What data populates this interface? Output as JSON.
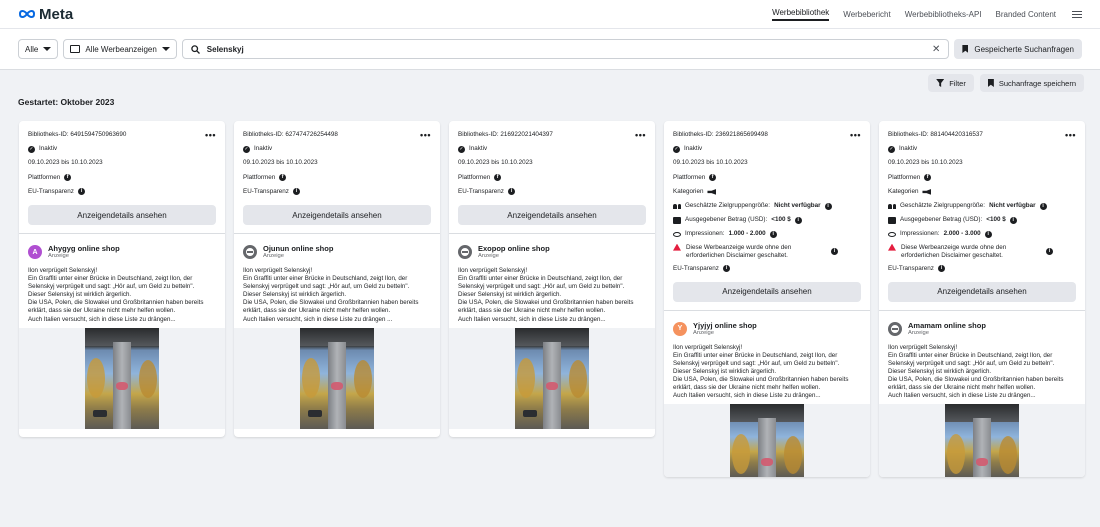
{
  "header": {
    "logo_text": "Meta",
    "nav": [
      {
        "label": "Werbebibliothek",
        "active": true
      },
      {
        "label": "Werbebericht",
        "active": false
      },
      {
        "label": "Werbebibliotheks-API",
        "active": false
      },
      {
        "label": "Branded Content",
        "active": false
      }
    ]
  },
  "search": {
    "country": "Alle",
    "ad_category": "Alle Werbeanzeigen",
    "query": "Selenskyj",
    "saved_searches_label": "Gespeicherte Suchanfragen"
  },
  "toolbar": {
    "filter_label": "Filter",
    "save_search_label": "Suchanfrage speichern"
  },
  "section_title": "Gestartet: Oktober 2023",
  "colors": {
    "accent": "#1c1e21",
    "warning": "#e41e3f",
    "avatar_purple": "#b04fd1",
    "avatar_orange": "#f5925e"
  },
  "cards": [
    {
      "library_id": "Bibliotheks-ID: 649159475096369​0",
      "status": "Inaktiv",
      "dates": "09.10.2023 bis 10.10.2023",
      "platforms_label": "Plattformen",
      "eu_label": "EU-Transparenz",
      "details_button": "Anzeigendetails ansehen",
      "advertiser": "Ahygyg online shop",
      "advertiser_initial": "A",
      "sponsored": "Anzeige",
      "ad_text": [
        "Ilon verprügelt Selenskyj!",
        "Ein Graffiti unter einer Brücke in Deutschland, zeigt Ilon, der Selenskyj verprügelt und sagt: „Hör auf, um Geld zu betteln\".",
        "Dieser Selenskyj ist wirklich ärgerlich.",
        "Die USA, Polen, die Slowakei und Großbritannien haben bereits erklärt, dass sie der Ukraine nicht mehr helfen wollen.",
        "Auch Italien versucht, sich in diese Liste zu drängen..."
      ]
    },
    {
      "library_id": "Bibliotheks-ID: 627474726254498",
      "status": "Inaktiv",
      "dates": "09.10.2023 bis 10.10.2023",
      "platforms_label": "Plattformen",
      "eu_label": "EU-Transparenz",
      "details_button": "Anzeigendetails ansehen",
      "advertiser": "Ojunun online shop",
      "sponsored": "Anzeige",
      "ad_text": [
        "Ilon verprügelt Selenskyj!",
        "Ein Graffiti unter einer Brücke in Deutschland, zeigt Ilon, der Selenskyj verprügelt und sagt: „Hör auf, um Geld zu betteln\".",
        "Dieser Selenskyj ist wirklich ärgerlich.",
        "Die USA, Polen, die Slowakei und Großbritannien haben bereits erklärt, dass sie der Ukraine nicht mehr helfen wollen.",
        "Auch Italien versucht, sich in diese Liste zu drängen ..."
      ]
    },
    {
      "library_id": "Bibliotheks-ID: 216922021404397",
      "status": "Inaktiv",
      "dates": "09.10.2023 bis 10.10.2023",
      "platforms_label": "Plattformen",
      "eu_label": "EU-Transparenz",
      "details_button": "Anzeigendetails ansehen",
      "advertiser": "Exopop online shop",
      "sponsored": "Anzeige",
      "ad_text": [
        "Ilon verprügelt Selenskyj!",
        "Ein Graffiti unter einer Brücke in Deutschland, zeigt Ilon, der Selenskyj verprügelt und sagt: „Hör auf, um Geld zu betteln\".",
        "Dieser Selenskyj ist wirklich ärgerlich.",
        "Die USA, Polen, die Slowakei und Großbritannien haben bereits erklärt, dass sie der Ukraine nicht mehr helfen wollen.",
        "Auch Italien versucht, sich in diese Liste zu drängen..."
      ]
    },
    {
      "library_id": "Bibliotheks-ID: 236921865699498",
      "status": "Inaktiv",
      "dates": "09.10.2023 bis 10.10.2023",
      "platforms_label": "Plattformen",
      "categories_label": "Kategorien",
      "audience_label": "Geschätzte Zielgruppengröße:",
      "audience_value": "Nicht verfügbar",
      "spend_label": "Ausgegebener Betrag (USD):",
      "spend_value": "<100 $",
      "impressions_label": "Impressionen:",
      "impressions_value": "1.000 - 2.000",
      "disclaimer": "Diese Werbeanzeige wurde ohne den erforderlichen Disclaimer geschaltet.",
      "eu_label": "EU-Transparenz",
      "details_button": "Anzeigendetails ansehen",
      "advertiser": "Yjyjyj online shop",
      "advertiser_initial": "Y",
      "sponsored": "Anzeige",
      "ad_text": [
        "Ilon verprügelt Selenskyj!",
        "Ein Graffiti unter einer Brücke in Deutschland, zeigt Ilon, der Selenskyj verprügelt und sagt: „Hör auf, um Geld zu betteln\".",
        "Dieser Selenskyj ist wirklich ärgerlich.",
        "Die USA, Polen, die Slowakei und Großbritannien haben bereits erklärt, dass sie der Ukraine nicht mehr helfen wollen.",
        "Auch Italien versucht, sich in diese Liste zu drängen..."
      ]
    },
    {
      "library_id": "Bibliotheks-ID: 881404420316537",
      "status": "Inaktiv",
      "dates": "09.10.2023 bis 10.10.2023",
      "platforms_label": "Plattformen",
      "categories_label": "Kategorien",
      "audience_label": "Geschätzte Zielgruppengröße:",
      "audience_value": "Nicht verfügbar",
      "spend_label": "Ausgegebener Betrag (USD):",
      "spend_value": "<100 $",
      "impressions_label": "Impressionen:",
      "impressions_value": "2.000 - 3.000",
      "disclaimer": "Diese Werbeanzeige wurde ohne den erforderlichen Disclaimer geschaltet.",
      "eu_label": "EU-Transparenz",
      "details_button": "Anzeigendetails ansehen",
      "advertiser": "Amamam online shop",
      "sponsored": "Anzeige",
      "ad_text": [
        "Ilon verprügelt Selenskyj!",
        "Ein Graffiti unter einer Brücke in Deutschland, zeigt Ilon, der Selenskyj verprügelt und sagt: „Hör auf, um Geld zu betteln\".",
        "Dieser Selenskyj ist wirklich ärgerlich.",
        "Die USA, Polen, die Slowakei und Großbritannien haben bereits erklärt, dass sie der Ukraine nicht mehr helfen wollen.",
        "Auch Italien versucht, sich in diese Liste zu drängen..."
      ]
    }
  ]
}
